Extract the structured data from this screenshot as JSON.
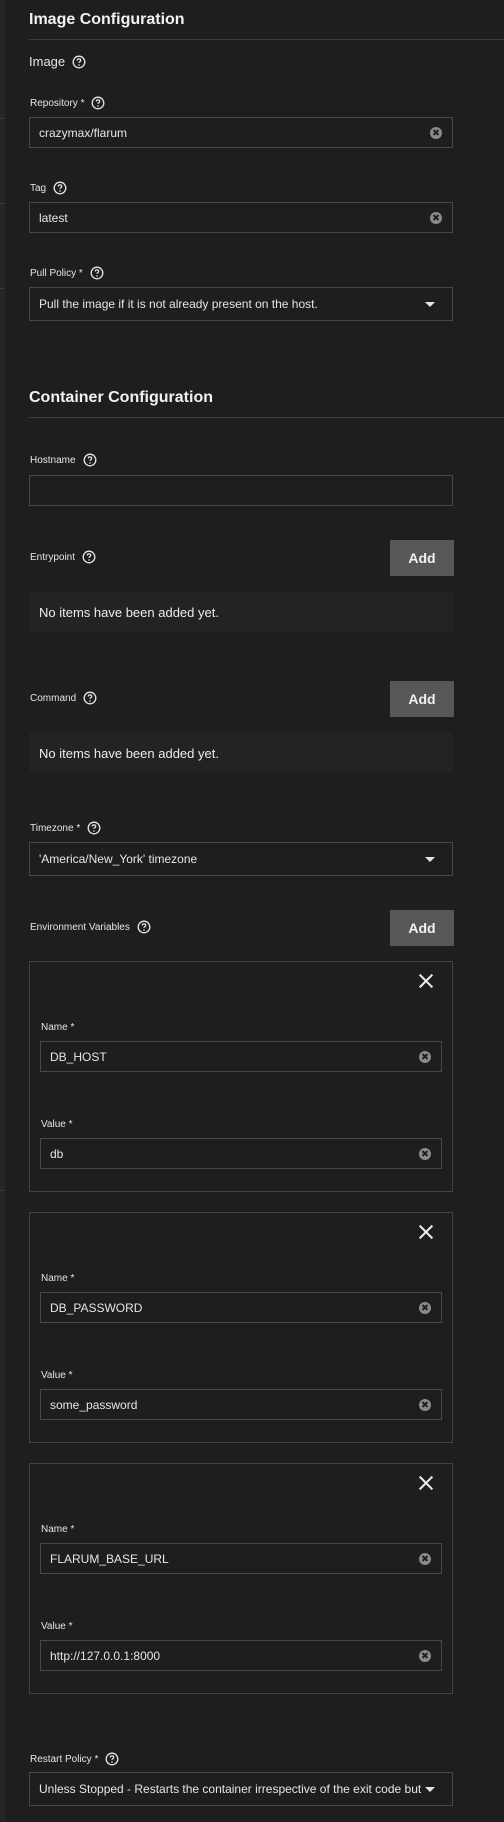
{
  "image_config": {
    "title": "Image Configuration",
    "image_label": "Image",
    "repository": {
      "label": "Repository *",
      "value": "crazymax/flarum"
    },
    "tag": {
      "label": "Tag",
      "value": "latest"
    },
    "pull_policy": {
      "label": "Pull Policy *",
      "value": "Pull the image if it is not already present on the host."
    }
  },
  "container_config": {
    "title": "Container Configuration",
    "hostname": {
      "label": "Hostname",
      "value": ""
    },
    "entrypoint": {
      "label": "Entrypoint",
      "add_label": "Add",
      "empty_text": "No items have been added yet."
    },
    "command": {
      "label": "Command",
      "add_label": "Add",
      "empty_text": "No items have been added yet."
    },
    "timezone": {
      "label": "Timezone *",
      "value": "'America/New_York' timezone"
    },
    "env_vars": {
      "label": "Environment Variables",
      "add_label": "Add",
      "name_label": "Name *",
      "value_label": "Value *",
      "items": [
        {
          "name": "DB_HOST",
          "value": "db"
        },
        {
          "name": "DB_PASSWORD",
          "value": "some_password"
        },
        {
          "name": "FLARUM_BASE_URL",
          "value": "http://127.0.0.1:8000"
        }
      ]
    },
    "restart_policy": {
      "label": "Restart Policy *",
      "value": "Unless Stopped - Restarts the container irrespective of the exit code but stops restarting when the service is stopped or removed."
    }
  },
  "icons": {
    "help": "help-circle-icon",
    "clear": "clear-circle-icon",
    "dropdown": "caret-down-icon",
    "remove": "close-icon"
  },
  "colors": {
    "background": "#1e1e1e",
    "button": "#575757",
    "border": "#484848",
    "text": "#e6e6e6"
  }
}
